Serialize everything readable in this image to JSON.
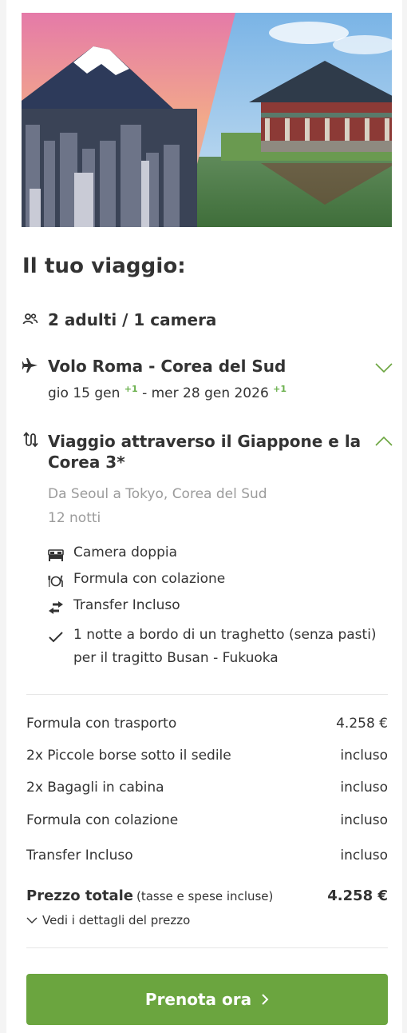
{
  "heading": "Il tuo viaggio:",
  "travellers": {
    "icon": "people-icon",
    "label": "2 adulti / 1 camera"
  },
  "flight": {
    "icon": "plane-icon",
    "title": "Volo Roma - Corea del Sud",
    "dates_part1": "gio 15 gen",
    "plus1": "+1",
    "dates_part2": "- mer 28 gen 2026",
    "plus2": "+1",
    "expand_icon": "chevron-down-icon"
  },
  "tour": {
    "icon": "route-icon",
    "title_line1": "Viaggio attraverso il Giappone e la",
    "title_line2": "Corea 3*",
    "collapse_icon": "chevron-up-icon",
    "route": "Da Seoul a Tokyo, Corea del Sud",
    "nights": "12 notti",
    "features": [
      {
        "icon": "bed-icon",
        "label": "Camera doppia"
      },
      {
        "icon": "cutlery-icon",
        "label": "Formula con colazione"
      },
      {
        "icon": "transfer-icon",
        "label": "Transfer Incluso"
      },
      {
        "icon": "check-icon",
        "label_line1": "1 notte a bordo di un traghetto (senza pasti)",
        "label_line2": "per il tragitto Busan - Fukuoka"
      }
    ]
  },
  "prices": [
    {
      "label": "Formula con trasporto",
      "value": "4.258 €"
    },
    {
      "label": "2x Piccole borse sotto il sedile",
      "value": "incluso"
    },
    {
      "label": "2x Bagagli in cabina",
      "value": "incluso"
    },
    {
      "label": "Formula con colazione",
      "value": "incluso"
    },
    {
      "label": "Transfer Incluso",
      "value": "incluso"
    }
  ],
  "total": {
    "label": "Prezzo totale",
    "sub": "(tasse e spese incluse)",
    "value": "4.258 €"
  },
  "details_link": "Vedi i dettagli del prezzo",
  "cta": {
    "label": "Prenota ora",
    "icon": "chevron-right-icon"
  },
  "colors": {
    "accent": "#6ba53f",
    "plus": "#6ab04c",
    "text": "#333333",
    "muted": "#9b9b9b"
  }
}
